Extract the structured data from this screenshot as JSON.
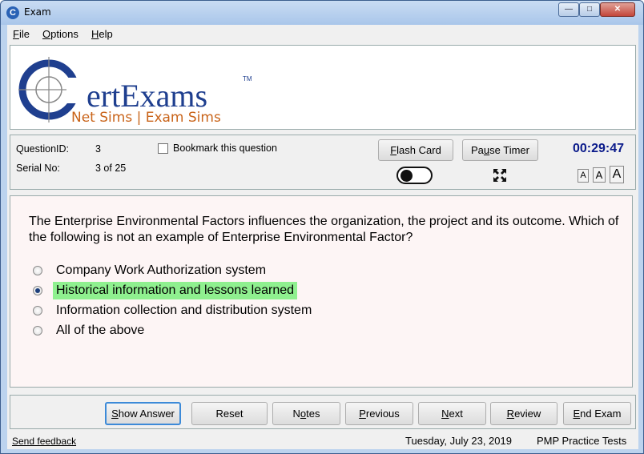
{
  "window": {
    "title": "Exam",
    "minimize": "—",
    "maximize": "□",
    "close": "✕",
    "icon_letter": "C"
  },
  "menu": [
    {
      "accel": "F",
      "rest": "ile"
    },
    {
      "accel": "O",
      "rest": "ptions"
    },
    {
      "accel": "H",
      "rest": "elp"
    }
  ],
  "logo": {
    "brand_letter": "C",
    "brand_rest": "ertExams",
    "tm": "TM",
    "tagline": "Net Sims | Exam Sims"
  },
  "info": {
    "question_id_label": "QuestionID:",
    "question_id_value": "3",
    "serial_label": "Serial No:",
    "serial_value": "3 of 25",
    "bookmark_label": "Bookmark this question",
    "flash_card": {
      "accel": "F",
      "rest": "lash Card"
    },
    "pause_timer": {
      "pre": "Pa",
      "accel": "u",
      "rest": "se Timer"
    },
    "timer": "00:29:47",
    "font_small": "A",
    "font_medium": "A",
    "font_large": "A"
  },
  "question": {
    "text": "The Enterprise Environmental Factors influences the organization, the project and its outcome. Which of the following is not an example of Enterprise Environmental Factor?",
    "options": [
      {
        "label": "Company Work Authorization system",
        "selected": false
      },
      {
        "label": "Historical information and lessons learned",
        "selected": true
      },
      {
        "label": "Information collection and distribution system",
        "selected": false
      },
      {
        "label": "All of the above",
        "selected": false
      }
    ]
  },
  "buttons": {
    "show_answer": {
      "accel": "S",
      "rest": "how Answer"
    },
    "reset": "Reset",
    "notes": {
      "pre": "N",
      "accel": "o",
      "rest": "tes"
    },
    "previous": {
      "accel": "P",
      "rest": "revious"
    },
    "next": {
      "accel": "N",
      "rest": "ext"
    },
    "review": {
      "accel": "R",
      "rest": "eview"
    },
    "end_exam": {
      "accel": "E",
      "rest": "nd Exam"
    }
  },
  "status": {
    "feedback": "Send feedback",
    "date": "Tuesday, July 23, 2019",
    "product": "PMP Practice Tests"
  },
  "colors": {
    "selected_highlight": "#8ff08f",
    "timer": "#0a1a8a",
    "logo_blue": "#1f3f8f",
    "logo_orange": "#c9641a"
  }
}
